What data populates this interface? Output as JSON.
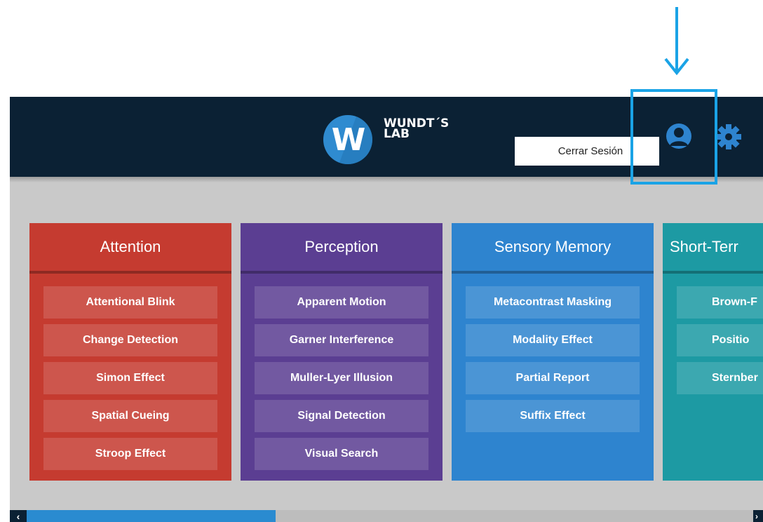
{
  "header": {
    "logo_letter": "W",
    "logo_line1": "WUNDT´S",
    "logo_line2": "LAB",
    "logout_label": "Cerrar Sesión"
  },
  "icons": {
    "user": "user-icon",
    "settings": "gear-icon",
    "annotation": "arrow-down-icon"
  },
  "colors": {
    "header_bg": "#0b2134",
    "attention": "#c53b30",
    "perception": "#5b3e92",
    "sensory_memory": "#2e84cf",
    "short_term": "#1d9aa3",
    "annotation": "#1aa3e6"
  },
  "categories": [
    {
      "title": "Attention",
      "items": [
        "Attentional Blink",
        "Change Detection",
        "Simon Effect",
        "Spatial Cueing",
        "Stroop Effect"
      ]
    },
    {
      "title": "Perception",
      "items": [
        "Apparent Motion",
        "Garner Interference",
        "Muller-Lyer Illusion",
        "Signal Detection",
        "Visual Search"
      ]
    },
    {
      "title": "Sensory Memory",
      "items": [
        "Metacontrast Masking",
        "Modality Effect",
        "Partial Report",
        "Suffix Effect"
      ]
    },
    {
      "title": "Short-Terr",
      "items": [
        "Brown-F",
        "Positio",
        "Sternber"
      ]
    }
  ],
  "scrollbar": {
    "left_arrow": "‹",
    "right_arrow": "›"
  }
}
